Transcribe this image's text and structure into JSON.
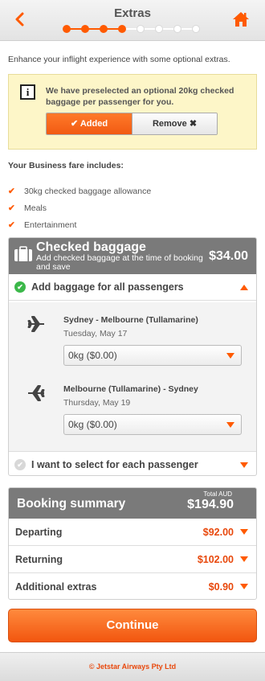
{
  "header": {
    "title": "Extras",
    "back_icon": "chevron-left-icon",
    "home_icon": "home-icon",
    "steps_total": 8,
    "steps_completed": 4,
    "accent": "#ff5a00"
  },
  "intro": "Enhance your inflight experience with some optional extras.",
  "notice": {
    "icon": "info-icon",
    "text": "We have preselected an optional 20kg checked baggage per passenger for you.",
    "added_label": "Added",
    "remove_label": "Remove"
  },
  "fare": {
    "title": "Your Business fare includes:",
    "items": [
      "30kg checked baggage allowance",
      "Meals",
      "Entertainment"
    ]
  },
  "baggage": {
    "title": "Checked baggage",
    "subtitle": "Add checked baggage at the time of booking and save",
    "price": "$34.00",
    "option_all": "Add baggage for all passengers",
    "option_each": "I want to select for each passenger",
    "flights": [
      {
        "route": "Sydney - Melbourne (Tullamarine)",
        "date": "Tuesday, May 17",
        "selected": "0kg ($0.00)"
      },
      {
        "route": "Melbourne (Tullamarine) - Sydney",
        "date": "Thursday, May 19",
        "selected": "0kg ($0.00)"
      }
    ]
  },
  "summary": {
    "title": "Booking summary",
    "total_label": "Total AUD",
    "total": "$194.90",
    "rows": [
      {
        "label": "Departing",
        "value": "$92.00"
      },
      {
        "label": "Returning",
        "value": "$102.00"
      },
      {
        "label": "Additional extras",
        "value": "$0.90"
      }
    ]
  },
  "continue_label": "Continue",
  "footer": "© Jetstar Airways Pty Ltd"
}
